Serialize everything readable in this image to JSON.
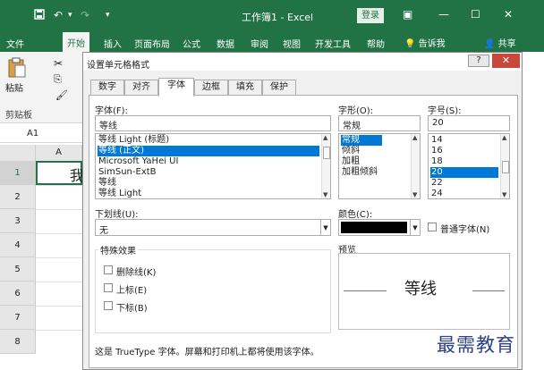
{
  "titlebar": {
    "save_icon": "save-icon",
    "undo_icon": "undo-icon",
    "redo_icon": "redo-icon",
    "doc_title": "工作簿1 - Excel",
    "login_label": "登录",
    "ribbon_display_icon": "ribbon-display-icon",
    "minimize_icon": "minimize-icon",
    "maximize_icon": "maximize-icon",
    "close_icon": "close-icon"
  },
  "ribbon": {
    "tabs": [
      "文件",
      "开始",
      "插入",
      "页面布局",
      "公式",
      "数据",
      "审阅",
      "视图",
      "开发工具",
      "帮助"
    ],
    "active_tab": "开始",
    "tell_me": "告诉我",
    "share": "共享",
    "paste_label": "粘贴",
    "clipboard_label": "剪贴板"
  },
  "namebox": {
    "value": "A1"
  },
  "grid": {
    "column_header": "A",
    "rows": [
      "1",
      "2",
      "3",
      "4",
      "5",
      "6",
      "7",
      "8"
    ],
    "cell_a1": "我"
  },
  "dialog": {
    "title": "设置单元格格式",
    "help_label": "?",
    "close_label": "✕",
    "tabs": [
      "数字",
      "对齐",
      "字体",
      "边框",
      "填充",
      "保护"
    ],
    "active_tab": "字体",
    "font": {
      "label": "字体(F):",
      "value": "等线",
      "options": [
        "等线 Light (标题)",
        "等线 (正文)",
        "Microsoft YaHei UI",
        "SimSun-ExtB",
        "等线",
        "等线 Light"
      ],
      "selected_index": 1
    },
    "style": {
      "label": "字形(O):",
      "value": "常规",
      "options": [
        "常规",
        "倾斜",
        "加粗",
        "加粗倾斜"
      ],
      "selected_index": 0
    },
    "size": {
      "label": "字号(S):",
      "value": "20",
      "options": [
        "14",
        "16",
        "18",
        "20",
        "22",
        "24"
      ],
      "selected_index": 3
    },
    "underline": {
      "label": "下划线(U):",
      "value": "无"
    },
    "color": {
      "label": "颜色(C):",
      "value": "#000000",
      "normal_font_label": "普通字体(N)"
    },
    "effects": {
      "title": "特殊效果",
      "strikethrough": "删除线(K)",
      "superscript": "上标(E)",
      "subscript": "下标(B)"
    },
    "preview": {
      "title": "预览",
      "sample": "等线"
    },
    "footer_note": "这是 TrueType 字体。屏幕和打印机上都将使用该字体。"
  },
  "watermark": "最需教育"
}
